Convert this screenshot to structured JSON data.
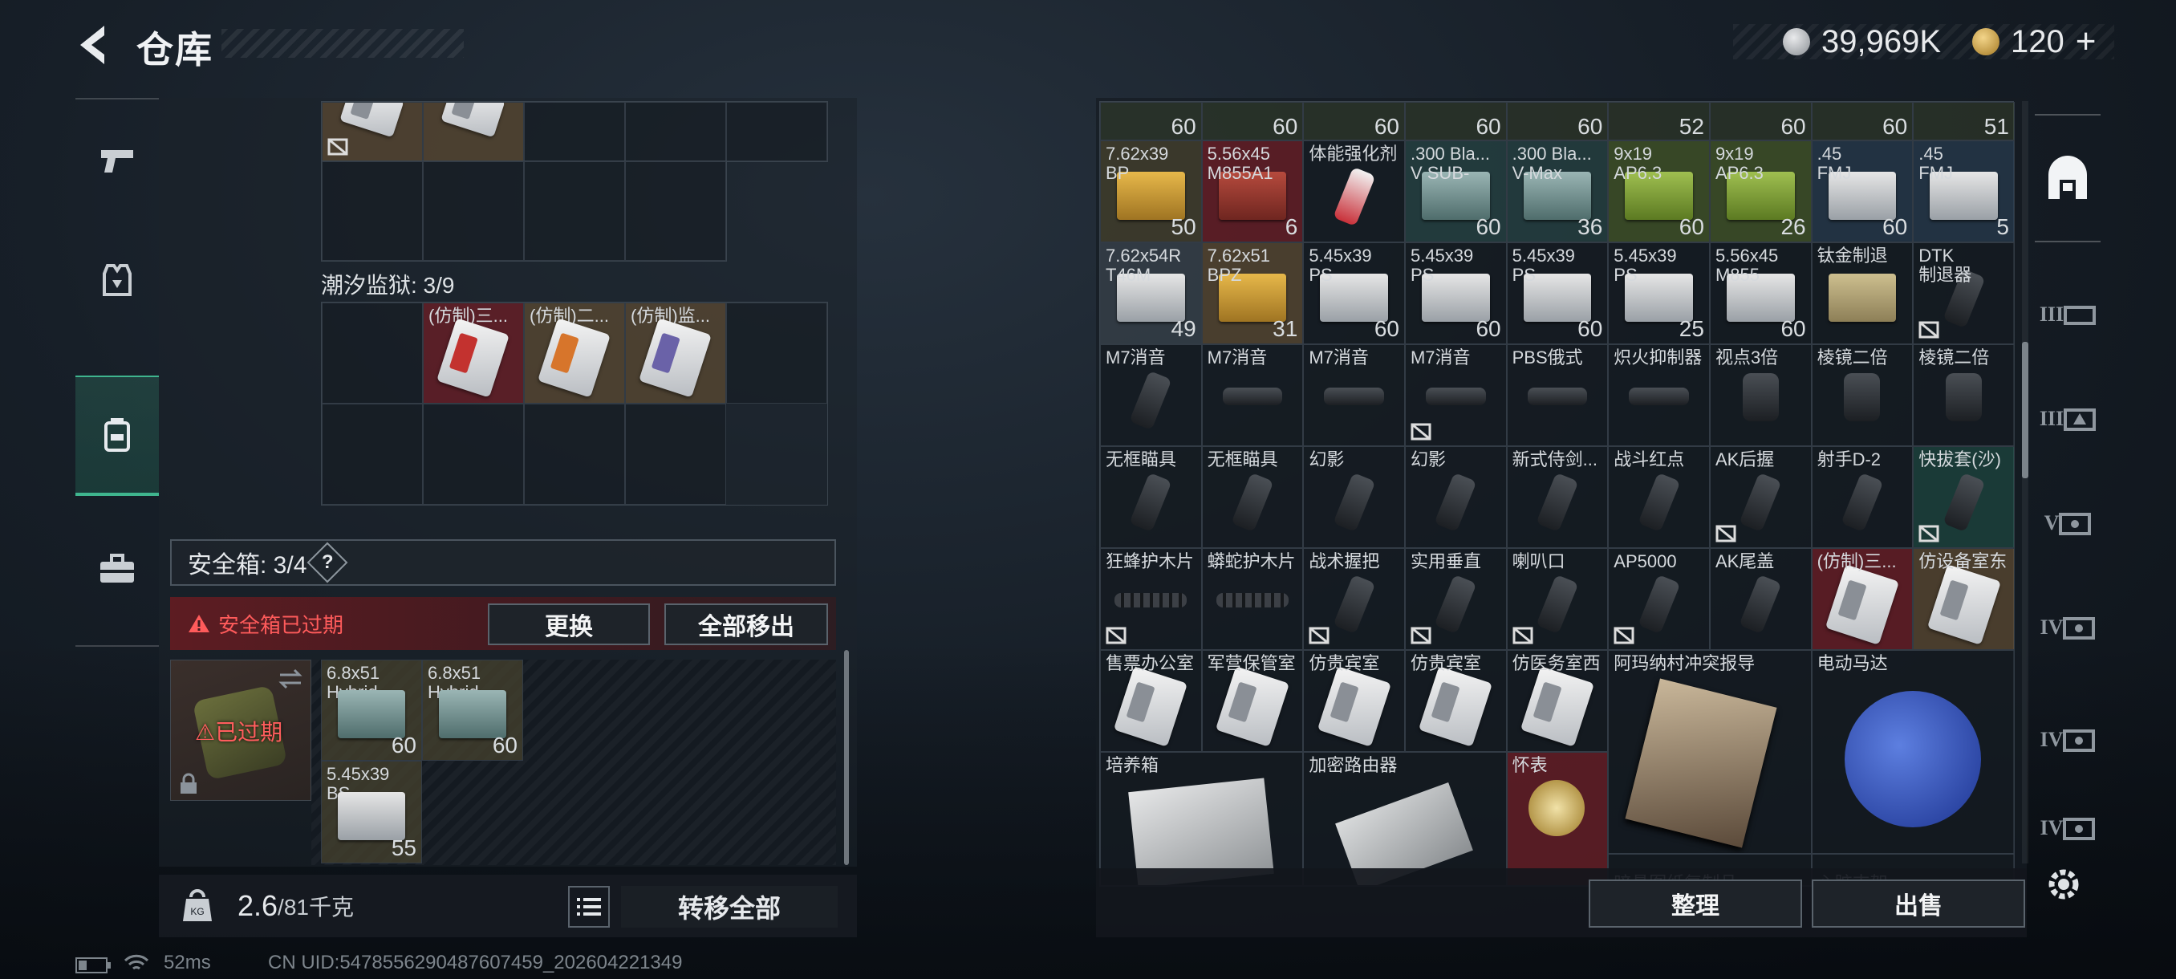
{
  "header": {
    "title": "仓库",
    "currency1": "39,969K",
    "currency2": "120",
    "plus": "+"
  },
  "left_nav": [
    "weapon-tab",
    "armor-tab",
    "backpack-tab",
    "case-tab"
  ],
  "prison": {
    "label": "潮汐监狱: 3/9",
    "items": [
      "(仿制)三...",
      "(仿制)二...",
      "(仿制)监..."
    ]
  },
  "safebox": {
    "label": "安全箱: 3/4",
    "q": "?",
    "warning": "安全箱已过期",
    "replace": "更换",
    "move_all": "全部移出",
    "expired": "已过期",
    "items": [
      {
        "name": "6.8x51\nHybrid",
        "qty": "60"
      },
      {
        "name": "6.8x51\nHybrid",
        "qty": "60"
      },
      {
        "name": "5.45x39\nBS",
        "qty": "55"
      }
    ]
  },
  "weight": {
    "current": "2.6",
    "max": "/81千克",
    "transfer_all": "转移全部"
  },
  "stash": {
    "top_qty": [
      "60",
      "60",
      "60",
      "60",
      "60",
      "52",
      "60",
      "60",
      "51"
    ],
    "items": [
      {
        "n": "7.62x39\nBP",
        "q": "50"
      },
      {
        "n": "5.56x45\nM855A1",
        "q": "6"
      },
      {
        "n": "体能强化剂",
        "q": ""
      },
      {
        "n": ".300 Bla...\nV SUB-",
        "q": "60"
      },
      {
        "n": ".300 Bla...\nV-Max",
        "q": "36"
      },
      {
        "n": "9x19\nAP6.3",
        "q": "60"
      },
      {
        "n": "9x19\nAP6.3",
        "q": "26"
      },
      {
        "n": ".45\nFMJ",
        "q": "60"
      },
      {
        "n": ".45\nFMJ",
        "q": "5"
      },
      {
        "n": "7.62x54R\nT46M",
        "q": "49"
      },
      {
        "n": "7.62x51\nBPZ",
        "q": "31"
      },
      {
        "n": "5.45x39\nPS",
        "q": "60"
      },
      {
        "n": "5.45x39\nPS",
        "q": "60"
      },
      {
        "n": "5.45x39\nPS",
        "q": "60"
      },
      {
        "n": "5.45x39\nPS",
        "q": "25"
      },
      {
        "n": "5.56x45\nM855",
        "q": "60"
      },
      {
        "n": "钛金制退",
        "q": ""
      },
      {
        "n": "DTK\n制退器",
        "q": ""
      },
      {
        "n": "M7消音",
        "q": ""
      },
      {
        "n": "M7消音",
        "q": ""
      },
      {
        "n": "M7消音",
        "q": ""
      },
      {
        "n": "M7消音",
        "q": ""
      },
      {
        "n": "PBS俄式",
        "q": ""
      },
      {
        "n": "炽火抑制器",
        "q": ""
      },
      {
        "n": "视点3倍",
        "q": ""
      },
      {
        "n": "棱镜二倍",
        "q": ""
      },
      {
        "n": "棱镜二倍",
        "q": ""
      },
      {
        "n": "无框瞄具",
        "q": ""
      },
      {
        "n": "无框瞄具",
        "q": ""
      },
      {
        "n": "幻影",
        "q": ""
      },
      {
        "n": "幻影",
        "q": ""
      },
      {
        "n": "新式侍剑...",
        "q": ""
      },
      {
        "n": "战斗红点",
        "q": ""
      },
      {
        "n": "AK后握",
        "q": ""
      },
      {
        "n": "射手D-2",
        "q": ""
      },
      {
        "n": "快拔套(沙)",
        "q": ""
      },
      {
        "n": "狂蜂护木片",
        "q": ""
      },
      {
        "n": "蟒蛇护木片",
        "q": ""
      },
      {
        "n": "战术握把",
        "q": ""
      },
      {
        "n": "实用垂直",
        "q": ""
      },
      {
        "n": "喇叭口",
        "q": ""
      },
      {
        "n": "AP5000",
        "q": ""
      },
      {
        "n": "AK尾盖",
        "q": ""
      },
      {
        "n": "(仿制)三...",
        "q": ""
      },
      {
        "n": "仿设备室东",
        "q": ""
      },
      {
        "n": "售票办公室",
        "q": ""
      },
      {
        "n": "军营保管室",
        "q": ""
      },
      {
        "n": "仿贵宾室",
        "q": ""
      },
      {
        "n": "仿贵宾室",
        "q": ""
      },
      {
        "n": "仿医务室西",
        "q": ""
      }
    ],
    "big_items": {
      "magazine": "阿玛纳村冲突报导",
      "motor": "电动马达",
      "incubator": "培养箱",
      "router": "加密路由器",
      "watch": "怀表"
    },
    "bottom_partial": [
      "模拟会印...",
      "暗悬图纸复制品",
      "心脏支架"
    ],
    "sort": "整理",
    "sell": "出售"
  },
  "right_nav_tiers": [
    "III",
    "III",
    "V",
    "IV",
    "IV",
    "IV"
  ],
  "status": {
    "ping": "52ms",
    "uid": "CN UID:5478556290487607459_202604221349"
  },
  "colors": {
    "accent": "#3fb58e",
    "warning": "#ff5b5b"
  }
}
